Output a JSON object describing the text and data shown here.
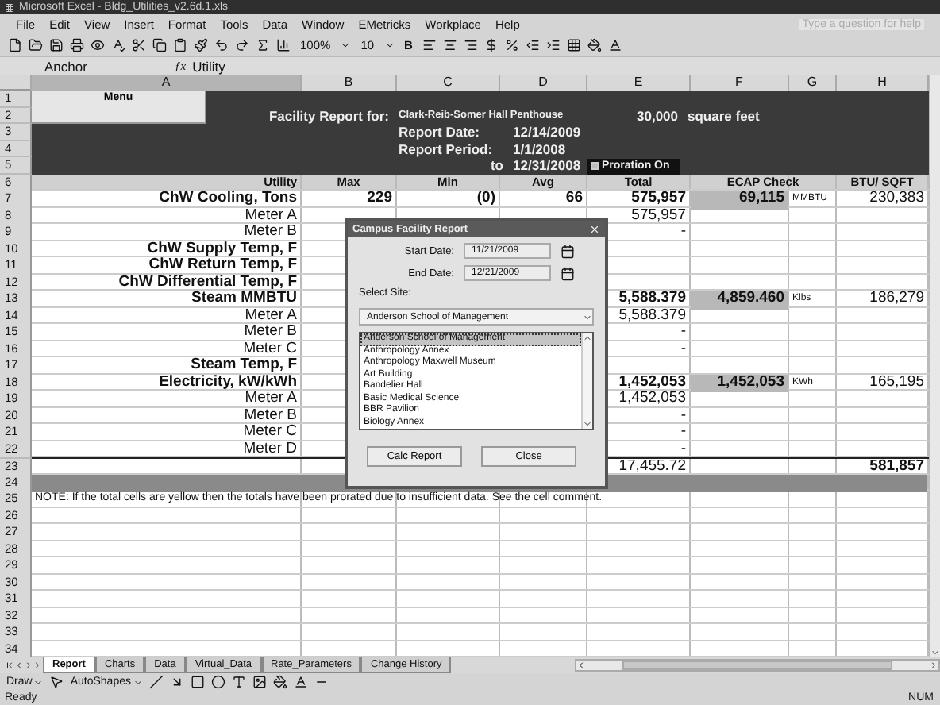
{
  "window": {
    "title": "Microsoft Excel - Bldg_Utilities_v2.6d.1.xls"
  },
  "menu": [
    "File",
    "Edit",
    "View",
    "Insert",
    "Format",
    "Tools",
    "Data",
    "Window",
    "EMetricks",
    "Workplace",
    "Help"
  ],
  "help_placeholder": "Type a question for help",
  "toolbar": {
    "zoom": "100%",
    "font_size": "10",
    "bold": "B"
  },
  "formula_bar": {
    "name_box": "Anchor",
    "fx_label": "ƒx",
    "formula": "Utility"
  },
  "columns": [
    {
      "label": "A",
      "selected": true
    },
    {
      "label": "B",
      "selected": false
    },
    {
      "label": "C",
      "selected": false
    },
    {
      "label": "D",
      "selected": false
    },
    {
      "label": "E",
      "selected": false
    },
    {
      "label": "F",
      "selected": false
    },
    {
      "label": "G",
      "selected": false
    },
    {
      "label": "H",
      "selected": false
    }
  ],
  "report_header": {
    "rows": [
      "1",
      "2",
      "3",
      "4",
      "5"
    ],
    "menu_button": "Menu",
    "title_label": "Facility Report for:",
    "site": "Clark-Reib-Somer Hall Penthouse",
    "area": "30,000",
    "area_unit": "square feet",
    "date_label": "Report Date:",
    "date": "12/14/2009",
    "period_label": "Report Period:",
    "period_start": "1/1/2008",
    "to_label": "to",
    "period_end": "12/31/2008",
    "proration": {
      "label": "Proration On",
      "checked": true
    }
  },
  "table_header": {
    "row": "6",
    "cells": {
      "a": "Utility",
      "b": "Max",
      "c": "Min",
      "d": "Avg",
      "e": "Total",
      "f": "ECAP Check",
      "h": "BTU/ SQFT"
    }
  },
  "rows": [
    {
      "row": "7",
      "kind": "metric",
      "cells": {
        "a": "ChW Cooling, Tons",
        "b": "229",
        "c": "(0)",
        "d": "66",
        "e": "575,957",
        "f": "69,115",
        "g": "MMBTU",
        "h": "230,383"
      }
    },
    {
      "row": "8",
      "kind": "meter",
      "cells": {
        "a": "Meter A",
        "e": "575,957"
      }
    },
    {
      "row": "9",
      "kind": "meter",
      "cells": {
        "a": "Meter B",
        "e": "-"
      }
    },
    {
      "row": "10",
      "kind": "metric",
      "cells": {
        "a": "ChW Supply Temp, F"
      }
    },
    {
      "row": "11",
      "kind": "metric",
      "cells": {
        "a": "ChW Return Temp, F"
      }
    },
    {
      "row": "12",
      "kind": "metric",
      "cells": {
        "a": "ChW Differential Temp, F"
      }
    },
    {
      "row": "13",
      "kind": "metric",
      "cells": {
        "a": "Steam MMBTU",
        "e": "5,588.379",
        "f": "4,859.460",
        "g": "Klbs",
        "h": "186,279"
      }
    },
    {
      "row": "14",
      "kind": "meter",
      "cells": {
        "a": "Meter A",
        "e": "5,588.379"
      }
    },
    {
      "row": "15",
      "kind": "meter",
      "cells": {
        "a": "Meter B",
        "e": "-"
      }
    },
    {
      "row": "16",
      "kind": "meter",
      "cells": {
        "a": "Meter C",
        "e": "-"
      }
    },
    {
      "row": "17",
      "kind": "metric",
      "cells": {
        "a": "Steam Temp, F"
      }
    },
    {
      "row": "18",
      "kind": "metric",
      "cells": {
        "a": "Electricity, kW/kWh",
        "e": "1,452,053",
        "f": "1,452,053",
        "g": "KWh",
        "h": "165,195"
      }
    },
    {
      "row": "19",
      "kind": "meter",
      "cells": {
        "a": "Meter A",
        "e": "1,452,053"
      }
    },
    {
      "row": "20",
      "kind": "meter",
      "cells": {
        "a": "Meter B",
        "e": "-"
      }
    },
    {
      "row": "21",
      "kind": "meter",
      "cells": {
        "a": "Meter C",
        "e": "-"
      }
    },
    {
      "row": "22",
      "kind": "meter",
      "cells": {
        "a": "Meter D",
        "e": "-"
      }
    },
    {
      "row": "23",
      "kind": "total",
      "cells": {
        "e": "17,455.72",
        "h": "581,857"
      }
    },
    {
      "row": "24",
      "kind": "band",
      "cells": {}
    },
    {
      "row": "25",
      "kind": "note",
      "cells": {
        "a": "NOTE:  If the total cells are yellow then the totals have been prorated due to insufficient data.  See the cell comment."
      }
    },
    {
      "row": "26",
      "kind": "blank",
      "cells": {}
    },
    {
      "row": "27",
      "kind": "blank",
      "cells": {}
    },
    {
      "row": "28",
      "kind": "blank",
      "cells": {}
    },
    {
      "row": "29",
      "kind": "blank",
      "cells": {}
    },
    {
      "row": "30",
      "kind": "blank",
      "cells": {}
    },
    {
      "row": "31",
      "kind": "blank",
      "cells": {}
    },
    {
      "row": "32",
      "kind": "blank",
      "cells": {}
    },
    {
      "row": "33",
      "kind": "blank",
      "cells": {}
    },
    {
      "row": "34",
      "kind": "blank",
      "cells": {}
    }
  ],
  "dialog": {
    "title": "Campus Facility Report",
    "start_label": "Start Date:",
    "start_date": "11/21/2009",
    "end_label": "End Date:",
    "end_date": "12/21/2009",
    "site_label": "Select Site:",
    "site_value": "Anderson School of Management",
    "sites": [
      {
        "label": "Anderson School of Management",
        "selected": true
      },
      {
        "label": "Anthropology Annex",
        "selected": false
      },
      {
        "label": "Anthropology Maxwell Museum",
        "selected": false
      },
      {
        "label": "Art Building",
        "selected": false
      },
      {
        "label": "Bandelier Hall",
        "selected": false
      },
      {
        "label": "Basic Medical Science",
        "selected": false
      },
      {
        "label": "BBR  Pavilion",
        "selected": false
      },
      {
        "label": "Biology Annex",
        "selected": false
      }
    ],
    "buttons": [
      "Calc Report",
      "Close"
    ]
  },
  "sheet_tabs": [
    {
      "label": "Report",
      "selected": true
    },
    {
      "label": "Charts",
      "selected": false
    },
    {
      "label": "Data",
      "selected": false
    },
    {
      "label": "Virtual_Data",
      "selected": false
    },
    {
      "label": "Rate_Parameters",
      "selected": false
    },
    {
      "label": "Change History",
      "selected": false
    }
  ],
  "draw_toolbar": {
    "draw": "Draw",
    "autoshapes": "AutoShapes"
  },
  "status_bar": {
    "left": "Ready",
    "right": "NUM"
  }
}
